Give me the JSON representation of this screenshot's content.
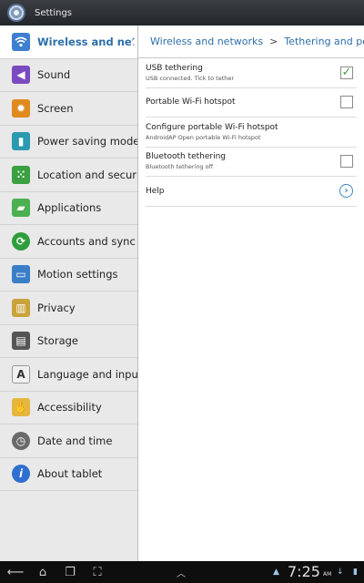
{
  "titlebar": {
    "title": "Settings",
    "icon": "settings-gear-icon"
  },
  "sidebar": {
    "items": [
      {
        "label": "Wireless and networks",
        "icon": "wifi-icon",
        "color": "#3d7fd0",
        "active": true
      },
      {
        "label": "Sound",
        "icon": "speaker-icon",
        "color": "#7a4bc0"
      },
      {
        "label": "Screen",
        "icon": "brightness-icon",
        "color": "#e08a1e"
      },
      {
        "label": "Power saving mode",
        "icon": "battery-icon",
        "color": "#2a9ab0"
      },
      {
        "label": "Location and security",
        "icon": "location-grid-icon",
        "color": "#3aa040"
      },
      {
        "label": "Applications",
        "icon": "applications-icon",
        "color": "#4caf50"
      },
      {
        "label": "Accounts and sync",
        "icon": "sync-icon",
        "color": "#2e9e3c"
      },
      {
        "label": "Motion settings",
        "icon": "tablet-motion-icon",
        "color": "#3b7ec8"
      },
      {
        "label": "Privacy",
        "icon": "privacy-icon",
        "color": "#c9a23a"
      },
      {
        "label": "Storage",
        "icon": "sd-card-icon",
        "color": "#555555"
      },
      {
        "label": "Language and input",
        "icon": "keyboard-a-icon",
        "color": "#f0f0f0"
      },
      {
        "label": "Accessibility",
        "icon": "hand-icon",
        "color": "#e5b640"
      },
      {
        "label": "Date and time",
        "icon": "clock-icon",
        "color": "#6a6a6a"
      },
      {
        "label": "About tablet",
        "icon": "info-icon",
        "color": "#2f6fcf"
      }
    ]
  },
  "breadcrumb": {
    "parent": "Wireless and networks",
    "separator": ">",
    "current": "Tethering and por"
  },
  "settings": [
    {
      "title": "USB tethering",
      "subtitle": "USB connected. Tick to tether",
      "control": "checkbox",
      "checked": true
    },
    {
      "title": "Portable Wi-Fi hotspot",
      "subtitle": "",
      "control": "checkbox",
      "checked": false
    },
    {
      "title": "Configure portable Wi-Fi hotspot",
      "subtitle": "AndroidAP Open portable Wi-Fi hotspot",
      "control": "none"
    },
    {
      "title": "Bluetooth tethering",
      "subtitle": "Bluetooth tethering off",
      "control": "checkbox",
      "checked": false
    },
    {
      "title": "Help",
      "subtitle": "",
      "control": "chevron"
    }
  ],
  "statusbar": {
    "time": "7:25",
    "ampm": "AM"
  }
}
